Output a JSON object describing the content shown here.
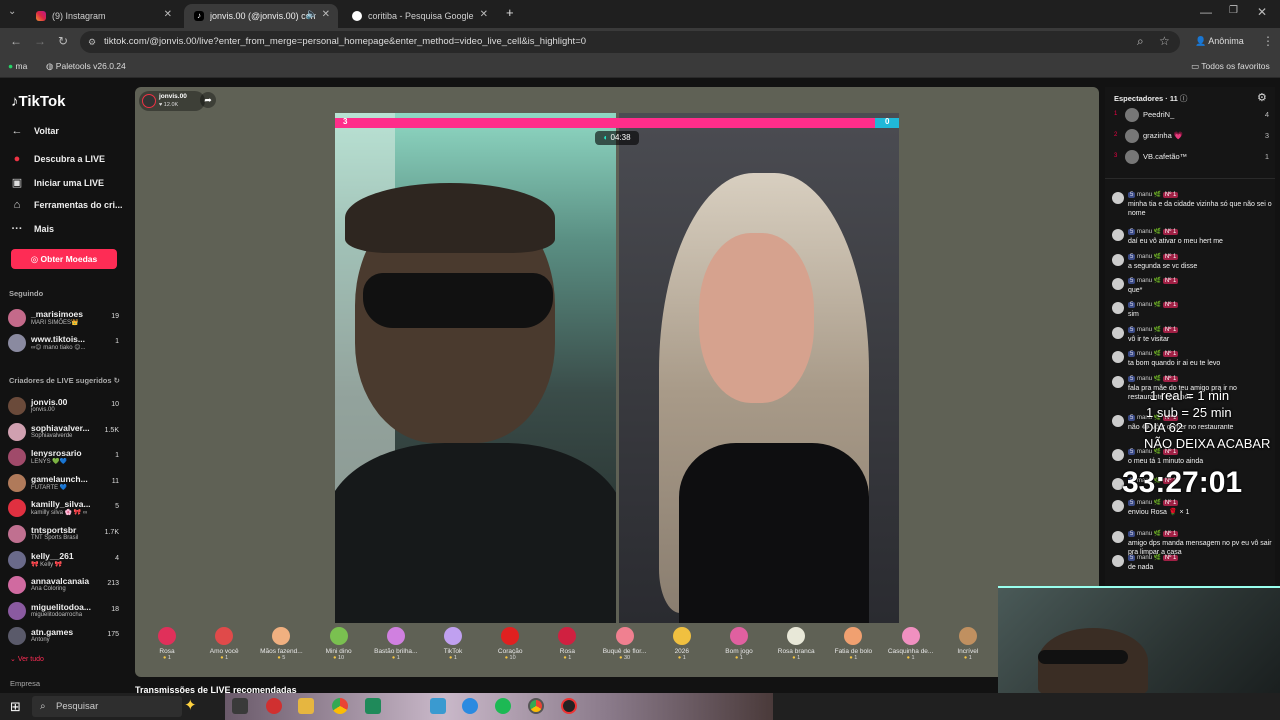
{
  "browser": {
    "tabs": [
      {
        "label": "(9) Instagram",
        "icon": "instagram-icon"
      },
      {
        "label": "jonvis.00 (@jonvis.00) come",
        "icon": "tiktok-icon"
      },
      {
        "label": "coritiba - Pesquisa Google",
        "icon": "google-icon"
      }
    ],
    "new_tab": "+",
    "url": "tiktok.com/@jonvis.00/live?enter_from_merge=personal_homepage&enter_method=video_live_cell&is_highlight=0",
    "profile_label": "Anônima",
    "bookmarks": [
      {
        "label": "ma"
      },
      {
        "label": "Paletools v26.0.24"
      }
    ],
    "all_favorites": "Todos os favoritos"
  },
  "sidebar": {
    "logo": "TikTok",
    "back": "Voltar",
    "nav": [
      "Descubra a LIVE",
      "Iniciar uma LIVE",
      "Ferramentas do cri...",
      "Mais"
    ],
    "coins_button": "Obter Moedas",
    "following_title": "Seguindo",
    "following": [
      {
        "name": "_marisimoes",
        "sub": "MARI SIMÕES👑",
        "count": "19"
      },
      {
        "name": "www.tiktois...",
        "sub": "∞😊 mano tiako 😊...",
        "count": "1"
      }
    ],
    "creators_title": "Criadores de LIVE sugeridos",
    "creators": [
      {
        "name": "jonvis.00",
        "sub": "jonvis.00",
        "count": "10"
      },
      {
        "name": "sophiavalver...",
        "sub": "Sophiavalverde",
        "count": "1.5K"
      },
      {
        "name": "lenysrosario",
        "sub": "LENYS 💚💙",
        "count": "1"
      },
      {
        "name": "gamelaunch...",
        "sub": "FUTARTE 💙",
        "count": "11"
      },
      {
        "name": "kamilly_silva...",
        "sub": "kamilly silva 🌸 🎀 ∞",
        "count": "5"
      },
      {
        "name": "tntsportsbr",
        "sub": "TNT Sports Brasil",
        "count": "1.7K"
      },
      {
        "name": "kelly__261",
        "sub": "🎀 Kelly 🎀",
        "count": "4"
      },
      {
        "name": "annavalcanaia",
        "sub": "Ana Coloring",
        "count": "213"
      },
      {
        "name": "miguelitodoa...",
        "sub": "miguelitodoarrocha",
        "count": "18"
      },
      {
        "name": "atn.games",
        "sub": "Antony",
        "count": "175"
      }
    ],
    "see_all": "Ver tudo",
    "company": "Empresa"
  },
  "stream": {
    "host_name": "jonvis.00",
    "host_likes": "♥ 12.0K",
    "score_left": "3",
    "score_right": "0",
    "timer": "04:38",
    "recommended_title": "Transmissões de LIVE recomendadas"
  },
  "gifts": [
    {
      "name": "Rosa",
      "price": "1",
      "color": "#e0305a"
    },
    {
      "name": "Amo você",
      "price": "1",
      "color": "#e04a4a"
    },
    {
      "name": "Mãos fazend...",
      "price": "5",
      "color": "#f0b080"
    },
    {
      "name": "Mini dino",
      "price": "10",
      "color": "#7ac050"
    },
    {
      "name": "Bastão brilha...",
      "price": "1",
      "color": "#d080e0"
    },
    {
      "name": "TikTok",
      "price": "1",
      "color": "#c0a0f0"
    },
    {
      "name": "Coração",
      "price": "10",
      "color": "#e02020"
    },
    {
      "name": "Rosa",
      "price": "1",
      "color": "#d02040"
    },
    {
      "name": "Buquê de flor...",
      "price": "30",
      "color": "#f08090"
    },
    {
      "name": "2026",
      "price": "1",
      "color": "#f0c040"
    },
    {
      "name": "Bom jogo",
      "price": "1",
      "color": "#e060a0"
    },
    {
      "name": "Rosa branca",
      "price": "1",
      "color": "#e8e8d8"
    },
    {
      "name": "Fatia de bolo",
      "price": "1",
      "color": "#f0a070"
    },
    {
      "name": "Casquinha de...",
      "price": "1",
      "color": "#f090c0"
    },
    {
      "name": "Incrível",
      "price": "1",
      "color": "#c09060"
    }
  ],
  "viewers": {
    "title": "Espectadores · 11",
    "list": [
      {
        "rank": "1",
        "name": "PeedriN_",
        "count": "4"
      },
      {
        "rank": "2",
        "name": "grazinha 💗",
        "count": "3"
      },
      {
        "rank": "3",
        "name": "VB.cafetão™",
        "count": "1"
      }
    ]
  },
  "chat": [
    {
      "user": "manu 🌿",
      "badge1": "5",
      "badge2": "Nº 1",
      "text": "minha tia e da cidade vizinha só que não sei o nome"
    },
    {
      "user": "manu 🌿",
      "badge1": "5",
      "badge2": "Nº 1",
      "text": "daí eu vô ativar o meu hert me"
    },
    {
      "user": "manu 🌿",
      "badge1": "5",
      "badge2": "Nº 1",
      "text": "a segunda se vc disse"
    },
    {
      "user": "manu 🌿",
      "badge1": "5",
      "badge2": "Nº 1",
      "text": "que*"
    },
    {
      "user": "manu 🌿",
      "badge1": "5",
      "badge2": "Nº 1",
      "text": "sim"
    },
    {
      "user": "manu 🌿",
      "badge1": "5",
      "badge2": "Nº 1",
      "text": "vô ir te visitar"
    },
    {
      "user": "manu 🌿",
      "badge1": "5",
      "badge2": "Nº 1",
      "text": "ta bom quando ir ai eu te levo"
    },
    {
      "user": "manu 🌿",
      "badge1": "5",
      "badge2": "Nº 1",
      "text": "fala pra mãe do teu amigo pra ir no restaurante com nós"
    },
    {
      "user": "manu 🌿",
      "badge1": "5",
      "badge2": "Nº 1",
      "text": "não 😂 vô ir comer no restaurante"
    },
    {
      "user": "manu 🌿",
      "badge1": "5",
      "badge2": "Nº 1",
      "text": "o meu tá 1 minuto ainda"
    },
    {
      "user": "manu 🌿",
      "badge1": "5",
      "badge2": "Nº 1",
      "text": ""
    },
    {
      "user": "manu 🌿",
      "badge1": "5",
      "badge2": "Nº 1",
      "text": "enviou Rosa 🌹 × 1"
    },
    {
      "user": "manu 🌿",
      "badge1": "5",
      "badge2": "Nº 1",
      "text": "amigo dps manda mensagem no pv eu vô sair pra limpar a casa"
    },
    {
      "user": "manu 🌿",
      "badge1": "5",
      "badge2": "Nº 1",
      "text": "de nada"
    }
  ],
  "overlay": {
    "line1": "1 real = 1 min",
    "line2": "1 sub = 25 min",
    "line3": "DIA 62",
    "line4": "NÃO DEIXA ACABAR",
    "timer": "33:27:01"
  },
  "taskbar": {
    "search_placeholder": "Pesquisar"
  }
}
